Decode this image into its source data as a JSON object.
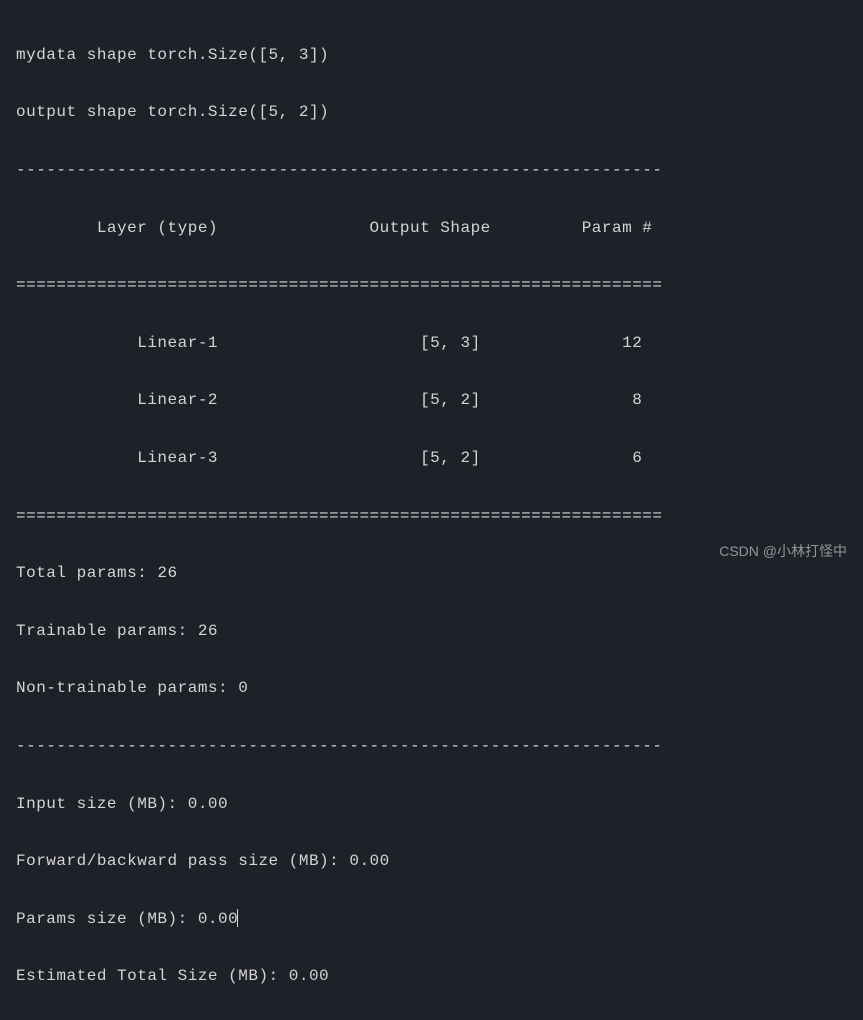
{
  "header": {
    "line1": "mydata shape torch.Size([5, 3])",
    "line2": "output shape torch.Size([5, 2])"
  },
  "separator_dash": "----------------------------------------------------------------",
  "separator_eq": "================================================================",
  "table_header": "        Layer (type)               Output Shape         Param #",
  "rows": {
    "r1": "            Linear-1                    [5, 3]              12",
    "r2": "            Linear-2                    [5, 2]               8",
    "r3": "            Linear-3                    [5, 2]               6"
  },
  "totals": {
    "total_params": "Total params: 26",
    "trainable_params": "Trainable params: 26",
    "non_trainable_params": "Non-trainable params: 0"
  },
  "sizes": {
    "input_size": "Input size (MB): 0.00",
    "forward_backward": "Forward/backward pass size (MB): 0.00",
    "params_size": "Params size (MB): 0.00",
    "estimated_total": "Estimated Total Size (MB): 0.00"
  },
  "watermark": "CSDN @小林打怪中"
}
